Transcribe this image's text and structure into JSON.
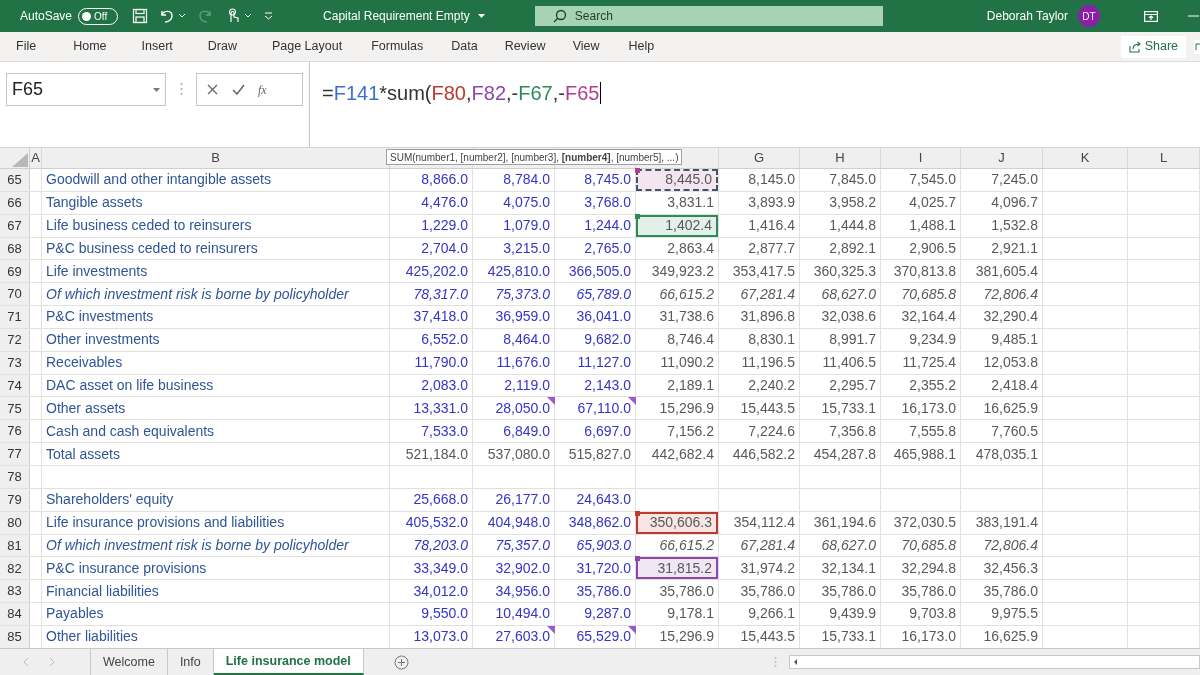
{
  "title_bar": {
    "autosave_label": "AutoSave",
    "autosave_toggle": {
      "label": "Off",
      "on": false
    },
    "redo_disabled": true,
    "document_title": "Capital Requirement Empty",
    "search": {
      "placeholder": "Search"
    },
    "user_name": "Deborah Taylor",
    "avatar": "DT"
  },
  "menu": [
    {
      "label": "File",
      "selected": false
    },
    {
      "label": "Home",
      "selected": false
    },
    {
      "label": "Insert",
      "selected": false
    },
    {
      "label": "Draw",
      "selected": false
    },
    {
      "label": "Page Layout",
      "selected": false
    },
    {
      "label": "Formulas",
      "selected": false
    },
    {
      "label": "Data",
      "selected": false
    },
    {
      "label": "Review",
      "selected": false
    },
    {
      "label": "View",
      "selected": false
    },
    {
      "label": "Help",
      "selected": false
    }
  ],
  "share_button": "Share",
  "formula_bar": {
    "name_box": "F65",
    "fx": "fx",
    "tokens": [
      {
        "text": "="
      },
      {
        "text": "F141",
        "color": "#3b6fd4"
      },
      {
        "text": "*sum("
      },
      {
        "text": "F80",
        "color": "#c0392b"
      },
      {
        "text": ","
      },
      {
        "text": "F82",
        "color": "#8e44ad"
      },
      {
        "text": ",-"
      },
      {
        "text": "F67",
        "color": "#2e8b57"
      },
      {
        "text": ",-"
      },
      {
        "text": "F65",
        "color": "#b0408f"
      }
    ]
  },
  "tooltip": "SUM(number1, [number2], [number3], **[number4]**, [number5], ...)",
  "column_headers": [
    "A",
    "B",
    "G",
    "H",
    "I",
    "J",
    "K",
    "L"
  ],
  "rows": [
    {
      "number": "65",
      "kind": "item",
      "italic": false,
      "label": "Goodwill and other intangible assets",
      "inputs": [
        "8,866.0",
        "8,784.0",
        "8,745.0"
      ],
      "projections": [
        {
          "text": "8,445.0",
          "color": "#b0408f",
          "dashed": true
        },
        "8,145.0",
        "7,845.0",
        "7,545.0",
        "7,245.0"
      ]
    },
    {
      "number": "66",
      "kind": "item",
      "italic": false,
      "label": "Tangible assets",
      "inputs": [
        "4,476.0",
        "4,075.0",
        "3,768.0"
      ],
      "projections": [
        "3,831.1",
        "3,893.9",
        "3,958.2",
        "4,025.7",
        "4,096.7"
      ]
    },
    {
      "number": "67",
      "kind": "item",
      "italic": false,
      "label": "Life business ceded to reinsurers",
      "inputs": [
        "1,229.0",
        "1,079.0",
        "1,244.0"
      ],
      "projections": [
        {
          "text": "1,402.4",
          "color": "#2e8b57",
          "dashed": false
        },
        "1,416.4",
        "1,444.8",
        "1,488.1",
        "1,532.8"
      ]
    },
    {
      "number": "68",
      "kind": "item",
      "italic": false,
      "label": "P&C business ceded to reinsurers",
      "inputs": [
        "2,704.0",
        "3,215.0",
        "2,765.0"
      ],
      "projections": [
        "2,863.4",
        "2,877.7",
        "2,892.1",
        "2,906.5",
        "2,921.1"
      ]
    },
    {
      "number": "69",
      "kind": "item",
      "italic": false,
      "label": "Life investments",
      "inputs": [
        "425,202.0",
        "425,810.0",
        "366,505.0"
      ],
      "projections": [
        "349,923.2",
        "353,417.5",
        "360,325.3",
        "370,813.8",
        "381,605.4"
      ]
    },
    {
      "number": "70",
      "kind": "item",
      "italic": true,
      "label": "Of which investment risk is borne by policyholder",
      "inputs": [
        "78,317.0",
        "75,373.0",
        "65,789.0"
      ],
      "projections": [
        "66,615.2",
        "67,281.4",
        "68,627.0",
        "70,685.8",
        "72,806.4"
      ]
    },
    {
      "number": "71",
      "kind": "item",
      "italic": false,
      "label": "P&C investments",
      "inputs": [
        "37,418.0",
        "36,959.0",
        "36,041.0"
      ],
      "projections": [
        "31,738.6",
        "31,896.8",
        "32,038.6",
        "32,164.4",
        "32,290.4"
      ]
    },
    {
      "number": "72",
      "kind": "item",
      "italic": false,
      "label": "Other investments",
      "inputs": [
        "6,552.0",
        "8,464.0",
        "9,682.0"
      ],
      "projections": [
        "8,746.4",
        "8,830.1",
        "8,991.7",
        "9,234.9",
        "9,485.1"
      ]
    },
    {
      "number": "73",
      "kind": "item",
      "italic": false,
      "label": "Receivables",
      "inputs": [
        "11,790.0",
        "11,676.0",
        "11,127.0"
      ],
      "projections": [
        "11,090.2",
        "11,196.5",
        "11,406.5",
        "11,725.4",
        "12,053.8"
      ]
    },
    {
      "number": "74",
      "kind": "item",
      "italic": false,
      "label": "DAC asset on life business",
      "inputs": [
        "2,083.0",
        "2,119.0",
        "2,143.0"
      ],
      "projections": [
        "2,189.1",
        "2,240.2",
        "2,295.7",
        "2,355.2",
        "2,418.4"
      ]
    },
    {
      "number": "75",
      "kind": "item",
      "italic": false,
      "label": "Other assets",
      "inputs": [
        "13,331.0",
        {
          "text": "28,050.0",
          "comment": true
        },
        {
          "text": "67,110.0",
          "comment": true
        }
      ],
      "projections": [
        "15,296.9",
        "15,443.5",
        "15,733.1",
        "16,173.0",
        "16,625.9"
      ]
    },
    {
      "number": "76",
      "kind": "item",
      "italic": false,
      "label": "Cash and cash equivalents",
      "inputs": [
        "7,533.0",
        "6,849.0",
        "6,697.0"
      ],
      "projections": [
        "7,156.2",
        "7,224.6",
        "7,356.8",
        "7,555.8",
        "7,760.5"
      ]
    },
    {
      "number": "77",
      "kind": "total",
      "italic": false,
      "label": "Total assets",
      "inputs": [
        "521,184.0",
        "537,080.0",
        "515,827.0"
      ],
      "projections": [
        "442,682.4",
        "446,582.2",
        "454,287.8",
        "465,988.1",
        "478,035.1"
      ]
    },
    {
      "number": "78",
      "kind": "blank"
    },
    {
      "number": "79",
      "kind": "item",
      "italic": false,
      "label": "Shareholders' equity",
      "inputs": [
        "25,668.0",
        "26,177.0",
        "24,643.0"
      ]
    },
    {
      "number": "80",
      "kind": "item",
      "italic": false,
      "label": "Life insurance provisions and liabilities",
      "inputs": [
        "405,532.0",
        "404,948.0",
        "348,862.0"
      ],
      "projections": [
        {
          "text": "350,606.3",
          "color": "#c0392b",
          "dashed": false
        },
        "354,112.4",
        "361,194.6",
        "372,030.5",
        "383,191.4"
      ]
    },
    {
      "number": "81",
      "kind": "item",
      "italic": true,
      "label": "Of which investment risk is borne by policyholder",
      "inputs": [
        "78,203.0",
        "75,357.0",
        "65,903.0"
      ],
      "projections": [
        "66,615.2",
        "67,281.4",
        "68,627.0",
        "70,685.8",
        "72,806.4"
      ]
    },
    {
      "number": "82",
      "kind": "item",
      "italic": false,
      "label": "P&C insurance provisions",
      "inputs": [
        "33,349.0",
        "32,902.0",
        "31,720.0"
      ],
      "projections": [
        {
          "text": "31,815.2",
          "color": "#8e44ad",
          "dashed": false
        },
        "31,974.2",
        "32,134.1",
        "32,294.8",
        "32,456.3"
      ]
    },
    {
      "number": "83",
      "kind": "item",
      "italic": false,
      "label": "Financial liabilities",
      "inputs": [
        "34,012.0",
        "34,956.0",
        "35,786.0"
      ],
      "projections": [
        "35,786.0",
        "35,786.0",
        "35,786.0",
        "35,786.0",
        "35,786.0"
      ]
    },
    {
      "number": "84",
      "kind": "item",
      "italic": false,
      "label": "Payables",
      "inputs": [
        "9,550.0",
        "10,494.0",
        "9,287.0"
      ],
      "projections": [
        "9,178.1",
        "9,266.1",
        "9,439.9",
        "9,703.8",
        "9,975.5"
      ]
    },
    {
      "number": "85",
      "kind": "item",
      "italic": false,
      "label": "Other liabilities",
      "inputs": [
        "13,073.0",
        {
          "text": "27,603.0",
          "comment": true
        },
        {
          "text": "65,529.0",
          "comment": true
        }
      ],
      "projections": [
        "15,296.9",
        "15,443.5",
        "15,733.1",
        "16,173.0",
        "16,625.9"
      ]
    }
  ],
  "sheet_tabs": [
    {
      "label": "Welcome",
      "selected": false
    },
    {
      "label": "Info",
      "selected": false
    },
    {
      "label": "Life insurance model",
      "selected": true
    }
  ]
}
